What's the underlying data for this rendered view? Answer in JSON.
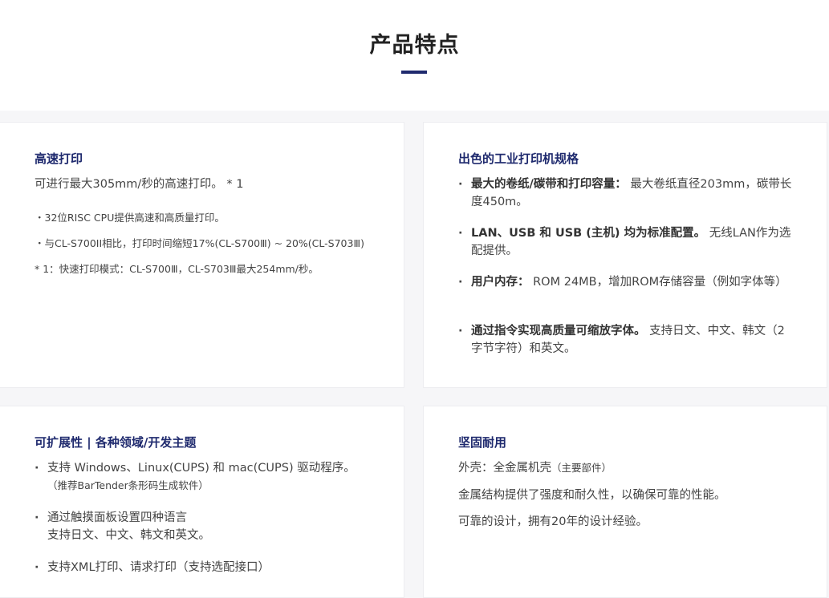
{
  "section": {
    "title": "产品特点"
  },
  "cards": {
    "speed": {
      "title": "高速打印",
      "intro": "可进行最大305mm/秒的高速打印。 * 1",
      "bullets": [
        "32位RISC CPU提供高速和高质量打印。",
        "与CL-S700II相比，打印时间缩短17%(CL-S700Ⅲ) ~ 20%(CL-S703Ⅲ)"
      ],
      "footnote": "* 1：快速打印模式：CL-S700Ⅲ，CL-S703Ⅲ最大254mm/秒。"
    },
    "specs": {
      "title": "出色的工业打印机规格",
      "items": [
        {
          "bold": "最大的卷纸/碳带和打印容量：",
          "text": "最大卷纸直径203mm，碳带长度450m。"
        },
        {
          "bold": "LAN、USB 和 USB (主机) 均为标准配置。",
          "text": "无线LAN作为选配提供。"
        },
        {
          "bold": "用户内存：",
          "text": "ROM 24MB，增加ROM存储容量（例如字体等）"
        },
        {
          "bold": "通过指令实现高质量可缩放字体。",
          "text": "支持日文、中文、韩文（2字节字符）和英文。"
        }
      ]
    },
    "extensibility": {
      "title": "可扩展性 | 各种领域/开发主题",
      "items": [
        {
          "main": "支持 Windows、Linux(CUPS) 和 mac(CUPS) 驱动程序。",
          "sub": "（推荐BarTender条形码生成软件）"
        },
        {
          "main": "通过触摸面板设置四种语言",
          "sub": "支持日文、中文、韩文和英文。"
        },
        {
          "main": "支持XML打印、请求打印（支持选配接口）",
          "sub": ""
        }
      ]
    },
    "durability": {
      "title": "坚固耐用",
      "case_label": "外壳：全金属机壳",
      "case_note": "（主要部件）",
      "lines": [
        "金属结构提供了强度和耐久性，以确保可靠的性能。",
        "可靠的设计，拥有20年的设计经验。"
      ]
    }
  }
}
